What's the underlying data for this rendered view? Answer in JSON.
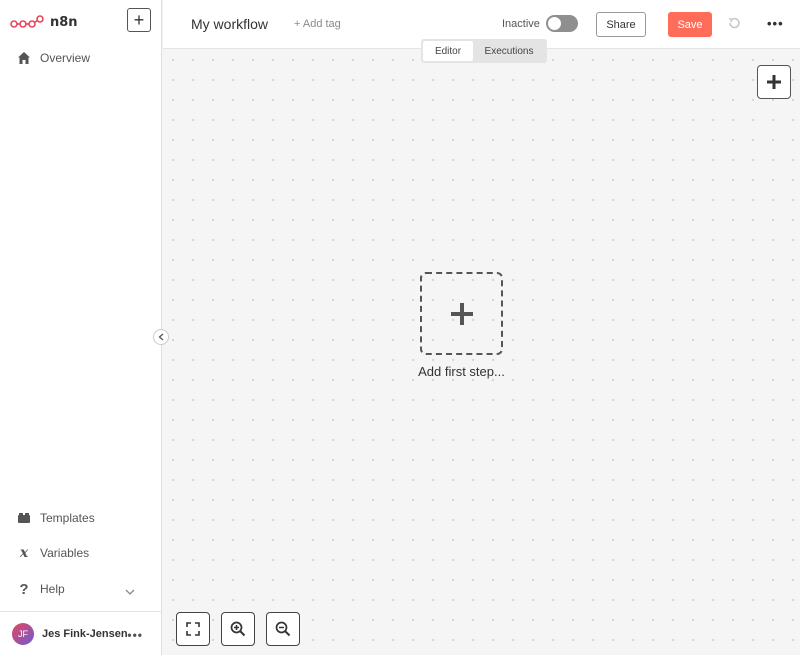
{
  "app": {
    "name": "n8n"
  },
  "sidebar": {
    "items": [
      {
        "label": "Overview",
        "icon": "home-icon"
      },
      {
        "label": "Templates",
        "icon": "box-icon"
      },
      {
        "label": "Variables",
        "icon": "variable-icon"
      },
      {
        "label": "Help",
        "icon": "question-icon"
      }
    ],
    "user": {
      "initials": "JF",
      "name": "Jes Fink-Jensen"
    }
  },
  "header": {
    "workflow_name": "My workflow",
    "add_tag": "+ Add tag",
    "status": "Inactive",
    "share_label": "Share",
    "save_label": "Save"
  },
  "tabs": [
    {
      "label": "Editor",
      "active": true
    },
    {
      "label": "Executions",
      "active": false
    }
  ],
  "canvas": {
    "add_first_step": "Add first step..."
  },
  "colors": {
    "accent": "#ff6d5a",
    "toggle_off": "#8f8f8f"
  }
}
